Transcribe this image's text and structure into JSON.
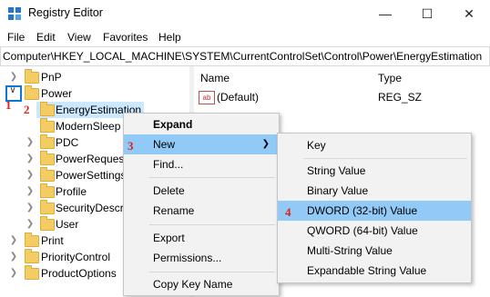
{
  "window": {
    "title": "Registry Editor",
    "minimize": "—",
    "maximize": "☐",
    "close": "✕"
  },
  "menu": [
    "File",
    "Edit",
    "View",
    "Favorites",
    "Help"
  ],
  "address": "Computer\\HKEY_LOCAL_MACHINE\\SYSTEM\\CurrentControlSet\\Control\\Power\\EnergyEstimation",
  "tree": {
    "pnp": "PnP",
    "power": "Power",
    "energy": "EnergyEstimation",
    "modernsleep": "ModernSleep",
    "pdc": "PDC",
    "powerrequest": "PowerRequest",
    "powersettings": "PowerSettings",
    "profile": "Profile",
    "securitydescr": "SecurityDescr",
    "user": "User",
    "print": "Print",
    "prioritycontrol": "PriorityControl",
    "productoptions": "ProductOptions"
  },
  "columns": {
    "name": "Name",
    "type": "Type"
  },
  "values": [
    {
      "name": "(Default)",
      "type": "REG_SZ",
      "icon": "ab"
    }
  ],
  "context_menu": {
    "expand": "Expand",
    "new": "New",
    "find": "Find...",
    "delete": "Delete",
    "rename": "Rename",
    "export": "Export",
    "permissions": "Permissions...",
    "copy_key": "Copy Key Name"
  },
  "submenu": {
    "key": "Key",
    "string": "String Value",
    "binary": "Binary Value",
    "dword": "DWORD (32-bit) Value",
    "qword": "QWORD (64-bit) Value",
    "multistring": "Multi-String Value",
    "expandable": "Expandable String Value"
  },
  "steps": {
    "s1": "1",
    "s2": "2",
    "s3": "3",
    "s4": "4"
  }
}
